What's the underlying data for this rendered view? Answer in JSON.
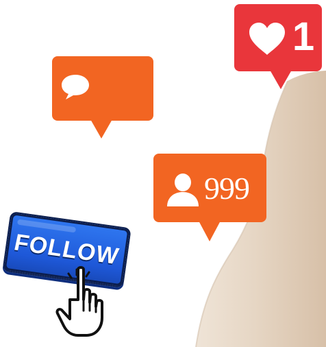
{
  "notifications": {
    "likes": {
      "icon": "heart-icon",
      "count": "1",
      "color": "#e9363b"
    },
    "comments": {
      "icon": "comment-icon",
      "color": "#f26522"
    },
    "followers": {
      "icon": "person-icon",
      "count": "999",
      "color": "#f26522"
    }
  },
  "follow_button": {
    "label": "FOLLOW",
    "color": "#1e58d8"
  },
  "cursor": {
    "icon": "hand-pointer-icon"
  }
}
